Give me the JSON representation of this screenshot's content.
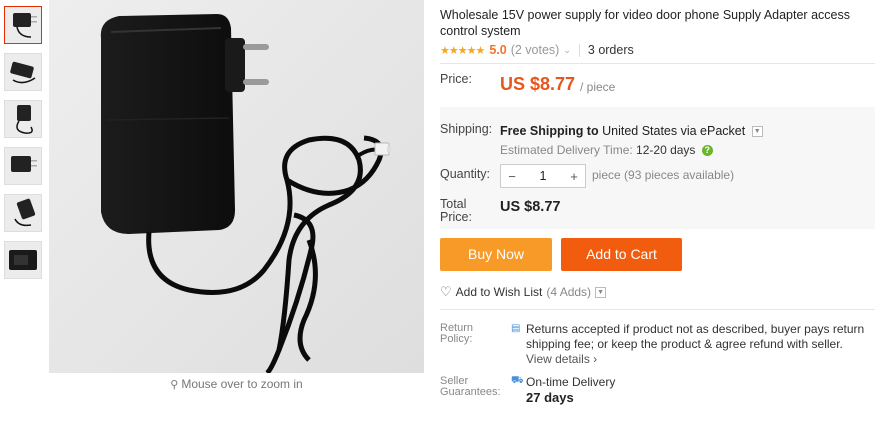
{
  "thumbnails": [
    {
      "name": "thumb-1",
      "active": true
    },
    {
      "name": "thumb-2"
    },
    {
      "name": "thumb-3"
    },
    {
      "name": "thumb-4"
    },
    {
      "name": "thumb-5"
    },
    {
      "name": "thumb-6"
    }
  ],
  "gallery": {
    "zoom_hint": "Mouse over to zoom in",
    "zoom_icon": "magnifier-icon"
  },
  "product": {
    "title": "Wholesale 15V power supply for video door phone Supply Adapter access control system",
    "stars": "★★★★★",
    "rating": "5.0",
    "votes": "(2 votes)",
    "orders": "3 orders"
  },
  "price": {
    "label": "Price:",
    "value": "US $8.77",
    "unit": "/ piece"
  },
  "shipping": {
    "label": "Shipping:",
    "method": "Free Shipping to",
    "destination": "United States via ePacket",
    "est_label": "Estimated Delivery Time:",
    "est_days": "12-20 days"
  },
  "quantity": {
    "label": "Quantity:",
    "minus": "−",
    "value": "1",
    "plus": "+",
    "note": "piece (93 pieces available)"
  },
  "total": {
    "label_line1": "Total",
    "label_line2": "Price:",
    "value": "US $8.77"
  },
  "buttons": {
    "buy_now": "Buy Now",
    "add_to_cart": "Add to Cart"
  },
  "wishlist": {
    "label": "Add to Wish List",
    "adds": "(4 Adds)"
  },
  "return_policy": {
    "label_line1": "Return",
    "label_line2": "Policy:",
    "text": "Returns accepted if product not as described, buyer pays return shipping fee; or keep the product & agree refund with seller.",
    "more": "View details ›"
  },
  "guarantee": {
    "label_line1": "Seller",
    "label_line2": "Guarantees:",
    "text": "On-time Delivery",
    "days": "27 days"
  },
  "colors": {
    "price": "#e8561e",
    "buy_now": "#f79a27",
    "add_to_cart": "#f25c0f",
    "star": "#f6a623"
  }
}
